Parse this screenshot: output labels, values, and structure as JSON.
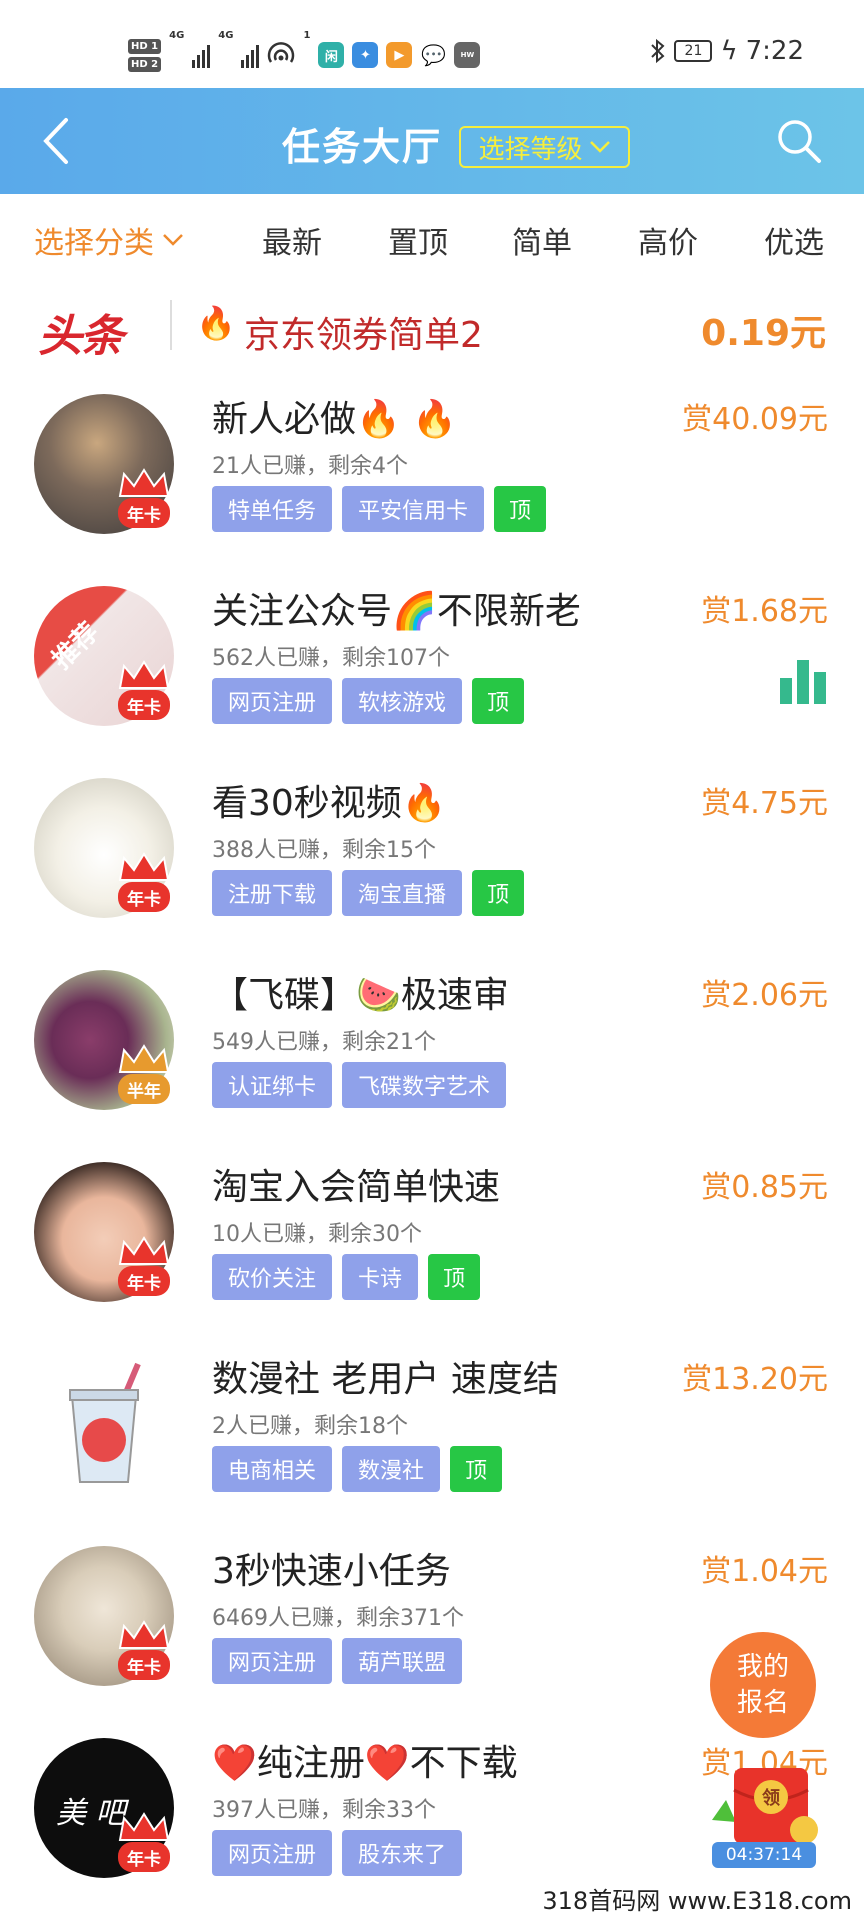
{
  "status_bar": {
    "hd1": "HD 1",
    "hd2": "HD 2",
    "net1": "4G",
    "net2": "4G",
    "hotspot_count": "1",
    "app1": "闲",
    "battery": "21",
    "time": "7:22"
  },
  "header": {
    "title": "任务大厅",
    "level_button": "选择等级",
    "back_icon": "chevron-left-icon",
    "search_icon": "search-icon",
    "bg_gradient": [
      "#5aa9ea",
      "#6cc4e8"
    ]
  },
  "filters": {
    "category": "选择分类",
    "tabs": [
      "最新",
      "置顶",
      "简单",
      "高价",
      "优选"
    ]
  },
  "headline": {
    "label": "头条",
    "text": "京东领券简单2",
    "price": "0.19元"
  },
  "tasks": [
    {
      "title": "新人必做",
      "emoji": "🔥 🔥",
      "stats": "21人已赚，剩余4个",
      "tags": [
        "特单任务",
        "平安信用卡"
      ],
      "top": "顶",
      "reward": "赏40.09元",
      "badge": "年卡"
    },
    {
      "title": "关注公众号",
      "emoji": "🌈",
      "title_suffix": "不限新老",
      "stats": "562人已赚，剩余107个",
      "tags": [
        "网页注册",
        "软核游戏"
      ],
      "top": "顶",
      "reward": "赏1.68元",
      "badge": "年卡",
      "ribbon": "推荐"
    },
    {
      "title": "看30秒视频",
      "emoji": "🔥",
      "stats": "388人已赚，剩余15个",
      "tags": [
        "注册下载",
        "淘宝直播"
      ],
      "top": "顶",
      "reward": "赏4.75元",
      "badge": "年卡"
    },
    {
      "title": "【飞碟】",
      "emoji": "🍉",
      "title_suffix": "极速审",
      "stats": "549人已赚，剩余21个",
      "tags": [
        "认证绑卡",
        "飞碟数字艺术"
      ],
      "top": "",
      "reward": "赏2.06元",
      "badge": "半年"
    },
    {
      "title": "淘宝入会简单快速",
      "emoji": "",
      "stats": "10人已赚，剩余30个",
      "tags": [
        "砍价关注",
        "卡诗"
      ],
      "top": "顶",
      "reward": "赏0.85元",
      "badge": "年卡"
    },
    {
      "title": "数漫社 老用户 速度结",
      "emoji": "",
      "stats": "2人已赚，剩余18个",
      "tags": [
        "电商相关",
        "数漫社"
      ],
      "top": "顶",
      "reward": "赏13.20元",
      "badge": ""
    },
    {
      "title": "3秒快速小任务",
      "emoji": "",
      "stats": "6469人已赚，剩余371个",
      "tags": [
        "网页注册",
        "葫芦联盟"
      ],
      "top": "",
      "reward": "赏1.04元",
      "badge": "年卡"
    },
    {
      "title": "纯注册",
      "emoji": "❤️",
      "title_suffix": "不下载",
      "stats": "397人已赚，剩余33个",
      "tags": [
        "网页注册",
        "股东来了"
      ],
      "top": "",
      "reward": "赏1.04元",
      "badge": "年卡",
      "avatar_text": "美 吧"
    }
  ],
  "floating": {
    "my_signup_line1": "我的",
    "my_signup_line2": "报名",
    "redpack_label": "领",
    "timer": "04:37:14"
  },
  "watermark": "318首码网  www.E318.com",
  "colors": {
    "accent_orange": "#ef8a2d",
    "tag_blue": "#8fa1ea",
    "tag_green": "#27c745",
    "headline_red": "#c12a2a"
  }
}
